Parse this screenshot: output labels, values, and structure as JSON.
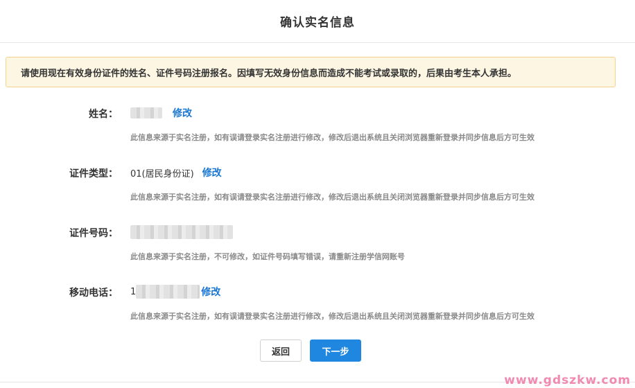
{
  "header": {
    "title": "确认实名信息"
  },
  "notice": {
    "text": "请使用现在有效身份证件的姓名、证件号码注册报名。因填写无效身份信息而造成不能考试或录取的，后果由考生本人承担。"
  },
  "fields": [
    {
      "label": "姓名：",
      "value": "",
      "edit_label": "修改",
      "hint": "此信息来源于实名注册，如有误请登录实名注册进行修改，修改后退出系统且关闭浏览器重新登录并同步信息后方可生效"
    },
    {
      "label": "证件类型：",
      "value": "01(居民身份证)",
      "edit_label": "修改",
      "hint": "此信息来源于实名注册，如有误请登录实名注册进行修改，修改后退出系统且关闭浏览器重新登录并同步信息后方可生效"
    },
    {
      "label": "证件号码：",
      "value": "",
      "hint": "此信息来源于实名注册，不可修改，如证件号码填写错误，请重新注册学信网账号"
    },
    {
      "label": "移动电话：",
      "value": "1",
      "edit_label": "修改",
      "hint": "此信息来源于实名注册，如有误请登录实名注册进行修改，修改后退出系统且关闭浏览器重新登录并同步信息后方可生效"
    }
  ],
  "buttons": {
    "back_label": "返回",
    "next_label": "下一步"
  },
  "watermark": "www.gdszkw.com",
  "colors": {
    "accent": "#1f87e0",
    "link": "#1976d2",
    "notice_bg": "#fdf6e3",
    "notice_border": "#f3d28a"
  }
}
